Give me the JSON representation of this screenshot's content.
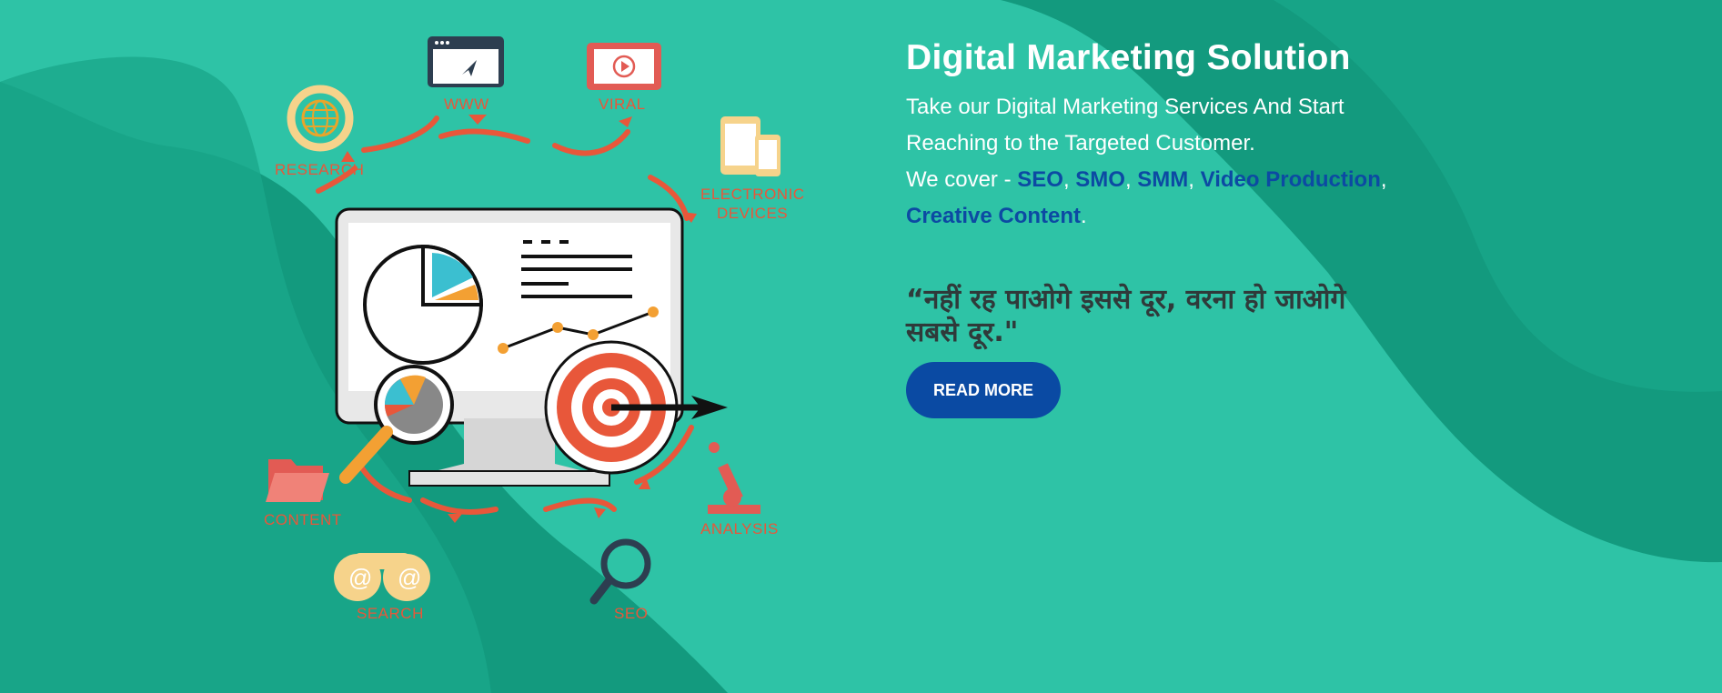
{
  "hero": {
    "title": "Digital Marketing Solution",
    "intro_line1": "Take our Digital Marketing Services And Start",
    "intro_line2": "Reaching to the Targeted Customer.",
    "cover_prefix": "We cover - ",
    "services": [
      "SEO",
      "SMO",
      "SMM",
      "Video Production",
      "Creative Content"
    ],
    "separator": ", ",
    "end_punct": ".",
    "quote_line1": "“नहीं रह पाओगे इससे दूर, वरना हो जाओगे",
    "quote_line2": "सबसे दूर.\"",
    "read_more": "READ MORE"
  },
  "illustration_labels": {
    "www": "WWW",
    "viral": "VIRAL",
    "research": "RESEARCH",
    "electronic": "ELECTRONIC",
    "devices": "DEVICES",
    "content": "CONTENT",
    "analysis": "ANALYSIS",
    "search": "SEARCH",
    "seo": "SEO"
  },
  "colors": {
    "background": "#2ec3a6",
    "wave_dark": "#139a7e",
    "link": "#0c4aa3",
    "button": "#0a4aa3",
    "accent_orange": "#e8573a"
  }
}
